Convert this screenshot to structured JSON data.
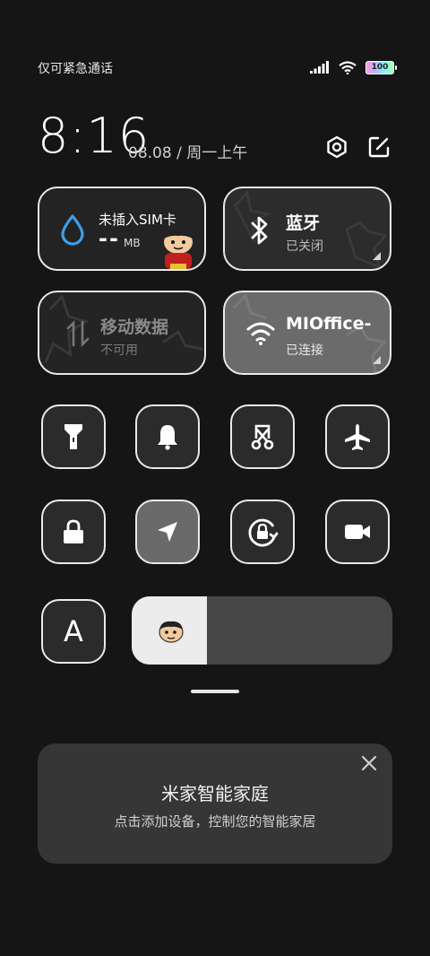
{
  "status_bar": {
    "carrier": "仅可紧急通话",
    "battery": "100"
  },
  "clock": {
    "time": "8:16",
    "date": "08.08 / 周一上午"
  },
  "tiles": {
    "sim": {
      "title": "未插入SIM卡",
      "value": "--",
      "unit": "MB"
    },
    "bluetooth": {
      "title": "蓝牙",
      "status": "已关闭"
    },
    "mobile_data": {
      "title": "移动数据",
      "status": "不可用"
    },
    "wifi": {
      "title": "MIOffice-",
      "status": "已连接"
    }
  },
  "toggles": [
    {
      "name": "flashlight",
      "icon": "flashlight-icon",
      "active": false
    },
    {
      "name": "ring",
      "icon": "bell-icon",
      "active": false
    },
    {
      "name": "screenshot",
      "icon": "scissors-icon",
      "active": false
    },
    {
      "name": "airplane",
      "icon": "airplane-icon",
      "active": false
    },
    {
      "name": "lock",
      "icon": "lock-icon",
      "active": false
    },
    {
      "name": "location",
      "icon": "location-arrow-icon",
      "active": true
    },
    {
      "name": "rotation-lock",
      "icon": "rotation-lock-icon",
      "active": false
    },
    {
      "name": "screen-record",
      "icon": "video-camera-icon",
      "active": false
    }
  ],
  "auto_brightness": {
    "label": "A"
  },
  "brightness": {
    "level": 0.29
  },
  "smart_home": {
    "title": "米家智能家庭",
    "subtitle": "点击添加设备，控制您的智能家居"
  },
  "colors": {
    "background": "#151515",
    "accent_blue": "#3d9ee8",
    "tile_border": "#e9e9e9"
  }
}
